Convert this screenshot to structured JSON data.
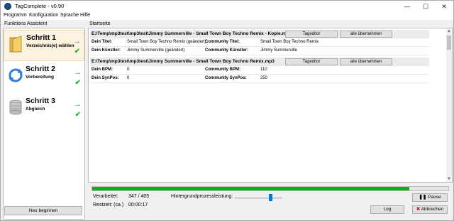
{
  "window": {
    "title": "TagComplete - v0.90",
    "min": "—",
    "max": "☐",
    "close": "✕"
  },
  "menu": [
    "Programm",
    "Konfiguration",
    "Sprache",
    "Hilfe"
  ],
  "left": {
    "header": "Funktions Assistent",
    "steps": [
      {
        "title": "Schritt 1",
        "subtitle": "Verzeichnis(e) wählen",
        "arrow": "→",
        "check": "✔"
      },
      {
        "title": "Schritt 2",
        "subtitle": "Vorbereitung",
        "arrow": "→",
        "check": "✔"
      },
      {
        "title": "Schritt 3",
        "subtitle": "Abgleich",
        "arrow": "→",
        "check": "✔"
      }
    ],
    "new_button": "Neu beginnen"
  },
  "main": {
    "header": "Startseite",
    "tag_button": "Tageditor",
    "apply_button": "alle übernehmen",
    "files": [
      {
        "path": "E:\\Temp\\mp3test\\mp3test\\Jimmy Summerville - Small Town Boy Techno Remix - Kopie.mp3",
        "rows": [
          {
            "l1": "Dein Titel:",
            "v1": "Small Town Boy Techno Remix (geändert)",
            "l2": "Community Titel:",
            "v2": "Small Town Boy Techno Remix"
          },
          {
            "l1": "Dein Künstler:",
            "v1": "Jimmy Summerville (geändert)",
            "l2": "Community Künstler:",
            "v2": "Jimmy Summerville"
          }
        ]
      },
      {
        "path": "E:\\Temp\\mp3test\\mp3test\\Jimmy Summerville - Small Town Boy Techno Remix.mp3",
        "rows": [
          {
            "l1": "Dein BPM:",
            "v1": "0",
            "l2": "Community BPM:",
            "v2": "110"
          },
          {
            "l1": "Dein SynPos:",
            "v1": "0",
            "l2": "Community SynPos:",
            "v2": "250"
          }
        ]
      }
    ]
  },
  "status": {
    "progress_fraction": 0.89,
    "processed_label": "Verarbeitet:",
    "processed_value": "347 / 405",
    "remaining_label": "Restzeit: (ca.)",
    "remaining_value": "00:00:17",
    "bg_label": "Hintergrundprozessleistung:",
    "bg_level": 0.78,
    "pause_button": "Pause",
    "log_button": "Log",
    "cancel_button": "Abbrechen"
  },
  "colors": {
    "progress": "#06b025",
    "accent": "#2f7fd8",
    "check": "#3aa83a"
  }
}
